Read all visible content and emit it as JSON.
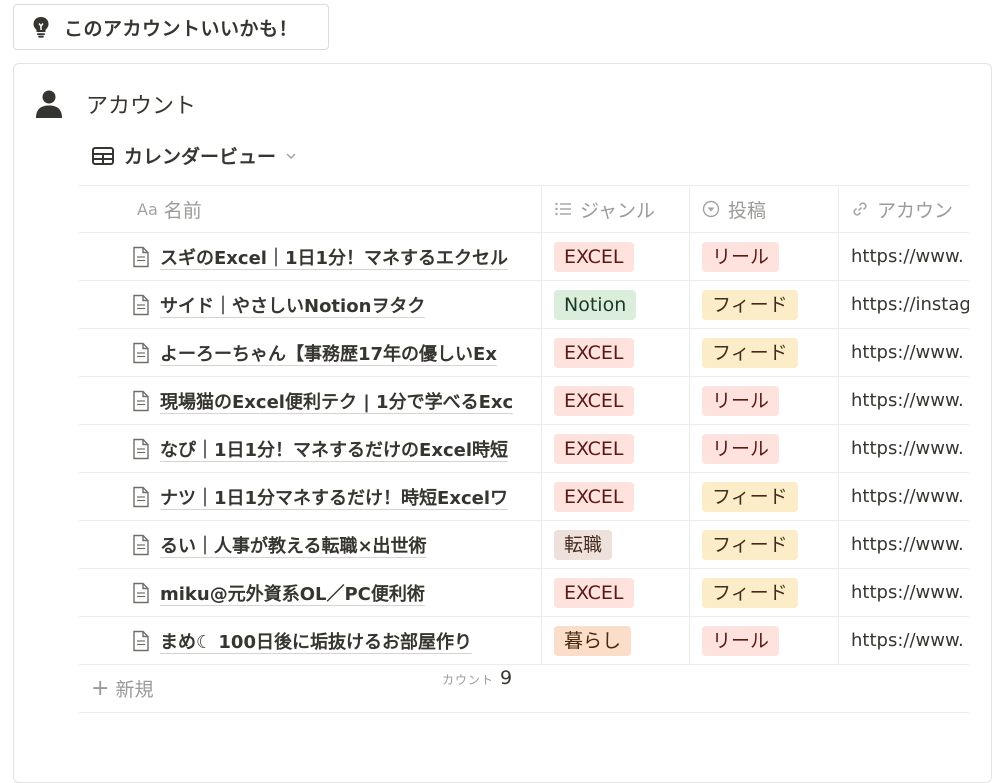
{
  "callout": {
    "label": "このアカウントいいかも！",
    "icon": "lightbulb-icon"
  },
  "database": {
    "title": "アカウント",
    "title_icon": "person-icon",
    "view_label": "カレンダービュー",
    "view_icon": "table-icon"
  },
  "columns": {
    "name": {
      "prefix": "Aa",
      "label": "名前"
    },
    "genre": {
      "icon": "list-icon",
      "label": "ジャンル"
    },
    "post": {
      "icon": "select-icon",
      "label": "投稿"
    },
    "account": {
      "icon": "link-icon",
      "label": "アカウン"
    }
  },
  "rows": [
    {
      "name": "スギのExcel｜1日1分！マネするエクセル",
      "genre": "EXCEL",
      "post": "リール",
      "account": "https://www."
    },
    {
      "name": "サイド｜やさしいNotionヲタク",
      "genre": "Notion",
      "post": "フィード",
      "account": "https://instag"
    },
    {
      "name": "よーろーちゃん【事務歴17年の優しいEx",
      "genre": "EXCEL",
      "post": "フィード",
      "account": "https://www."
    },
    {
      "name": "現場猫のExcel便利テク | 1分で学べるExc",
      "genre": "EXCEL",
      "post": "リール",
      "account": "https://www."
    },
    {
      "name": "なぴ｜1日1分！マネするだけのExcel時短",
      "genre": "EXCEL",
      "post": "リール",
      "account": "https://www."
    },
    {
      "name": "ナツ｜1日1分マネするだけ！時短Excelワ",
      "genre": "EXCEL",
      "post": "フィード",
      "account": "https://www."
    },
    {
      "name": "るい｜人事が教える転職×出世術",
      "genre": "転職",
      "post": "フィード",
      "account": "https://www."
    },
    {
      "name": "miku@元外資系OL／PC便利術",
      "genre": "EXCEL",
      "post": "フィード",
      "account": "https://www."
    },
    {
      "name": "まめ☾ 100日後に垢抜けるお部屋作り",
      "genre": "暮らし",
      "post": "リール",
      "account": "https://www."
    }
  ],
  "tag_colors": {
    "EXCEL": {
      "bg": "#fde2dd",
      "fg": "#5d1715"
    },
    "Notion": {
      "bg": "#dbeddb",
      "fg": "#1c3829"
    },
    "転職": {
      "bg": "#eee0da",
      "fg": "#44291e"
    },
    "暮らし": {
      "bg": "#fadec9",
      "fg": "#49290e"
    },
    "リール": {
      "bg": "#fde2dd",
      "fg": "#5d1715"
    },
    "フィード": {
      "bg": "#fdecc8",
      "fg": "#402c1b"
    }
  },
  "new_label": "新規",
  "count": {
    "label": "カウント",
    "value": "9"
  }
}
